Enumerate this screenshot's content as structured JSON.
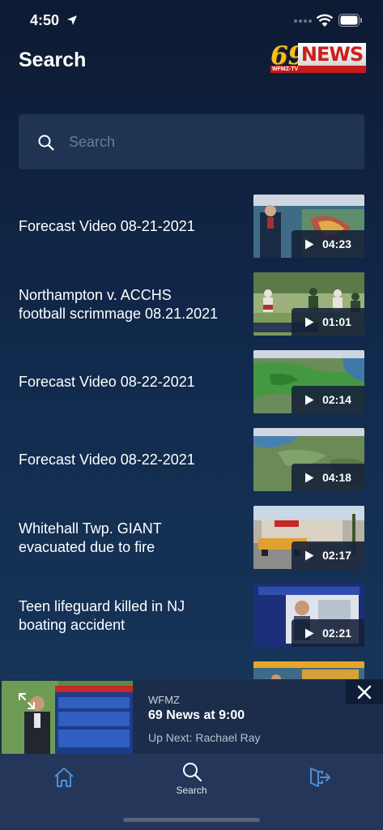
{
  "status_bar": {
    "time": "4:50"
  },
  "header": {
    "title": "Search",
    "logo": {
      "number": "69",
      "word": "NEWS",
      "sub": "WFMZ-TV"
    }
  },
  "search": {
    "placeholder": "Search",
    "value": ""
  },
  "results": [
    {
      "title": "Forecast Video 08-21-2021",
      "duration": "04:23"
    },
    {
      "title": "Northampton v.  ACCHS\nfootball scrimmage 08.21.2021",
      "duration": "01:01"
    },
    {
      "title": "Forecast Video 08-22-2021",
      "duration": "02:14"
    },
    {
      "title": "Forecast Video 08-22-2021",
      "duration": "04:18"
    },
    {
      "title": "Whitehall Twp. GIANT\nevacuated due to fire",
      "duration": "02:17"
    },
    {
      "title": "Teen lifeguard killed in NJ\nboating accident",
      "duration": "02:21"
    }
  ],
  "mini_player": {
    "station": "WFMZ",
    "program": "69 News at 9:00",
    "up_next": "Up Next: Rachael Ray"
  },
  "tab_bar": {
    "items": [
      {
        "label": "",
        "icon": "home-icon",
        "active": false
      },
      {
        "label": "Search",
        "icon": "search-icon",
        "active": true
      },
      {
        "label": "",
        "icon": "sign-out-icon",
        "active": false
      }
    ]
  },
  "colors": {
    "accent": "#4f8ed6",
    "background_top": "#0d1a33",
    "background_bottom": "#183a5e",
    "tab_bar": "#24375a"
  }
}
